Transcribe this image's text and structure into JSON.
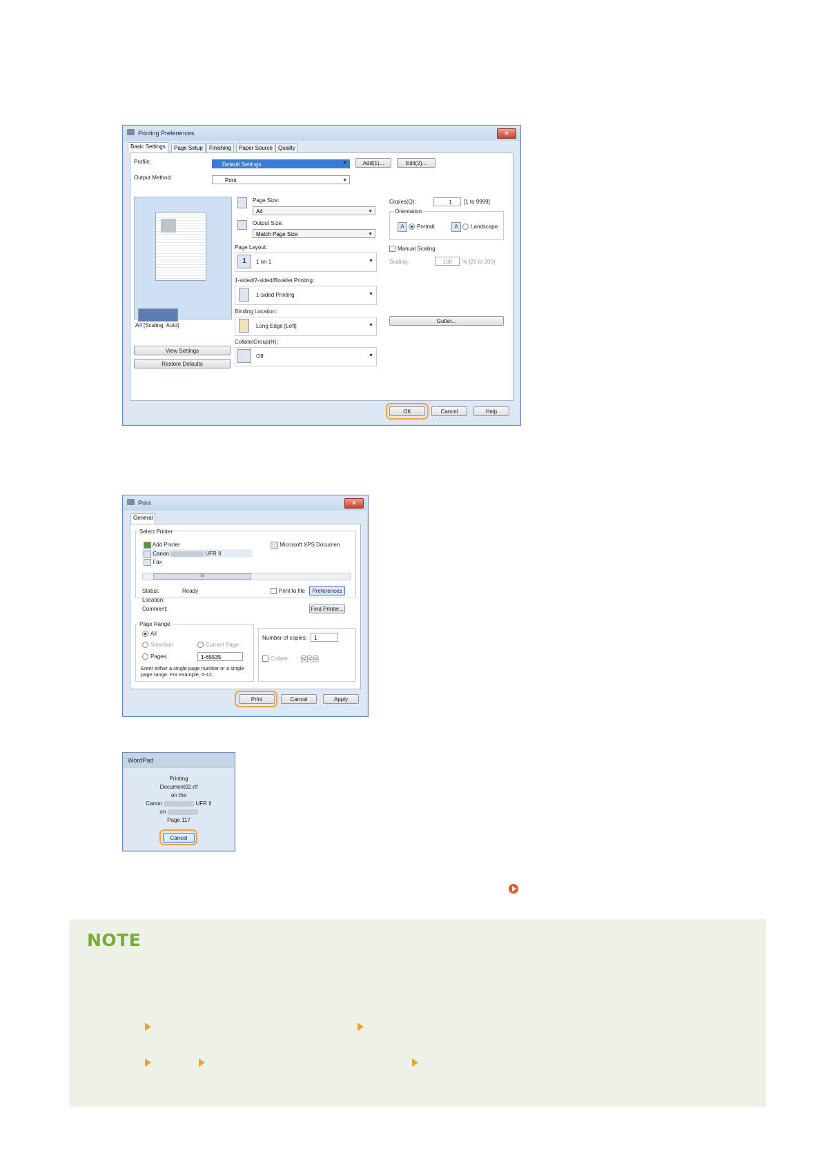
{
  "print_preferences": {
    "title": "Printing Preferences",
    "tabs": [
      "Basic Settings",
      "Page Setup",
      "Finishing",
      "Paper Source",
      "Quality"
    ],
    "profile_label": "Profile:",
    "profile_value": "Default Settings",
    "add_button": "Add(1)...",
    "edit_button": "Edit(2)...",
    "output_method_label": "Output Method:",
    "output_method_value": "Print",
    "page_size_label": "Page Size:",
    "page_size_value": "A4",
    "output_size_label": "Output Size:",
    "output_size_value": "Match Page Size",
    "page_layout_label": "Page Layout:",
    "page_layout_value": "1 on 1",
    "sided_label": "1-sided/2-sided/Booklet Printing:",
    "sided_value": "1-sided Printing",
    "binding_label": "Binding Location:",
    "binding_value": "Long Edge [Left]",
    "collate_label": "Collate/Group(H):",
    "collate_value": "Off",
    "copies_label": "Copies(Q):",
    "copies_value": "1",
    "copies_range": "[1 to 9999]",
    "orientation_label": "Orientation",
    "portrait": "Portrait",
    "landscape": "Landscape",
    "manual_scaling": "Manual Scaling",
    "scaling_label": "Scaling:",
    "scaling_value": "100",
    "scaling_range": "% [25 to 200]",
    "gutter_button": "Gutter...",
    "preview_caption": "A4 [Scaling: Auto]",
    "view_settings": "View Settings",
    "restore_defaults": "Restore Defaults",
    "ok": "OK",
    "cancel": "Cancel",
    "help": "Help",
    "layout_icon_text": "1"
  },
  "print_dialog": {
    "title": "Print",
    "tab": "General",
    "select_printer": "Select Printer",
    "printers": [
      "Add Printer",
      "Canon",
      "Fax"
    ],
    "printer_suffix": "UFR II",
    "xps": "Microsoft XPS Documen",
    "scroll_mid": "III",
    "status_label": "Status:",
    "status_value": "Ready",
    "location_label": "Location:",
    "comment_label": "Comment:",
    "print_to_file": "Print to file",
    "preferences": "Preferences",
    "find_printer": "Find Printer...",
    "page_range": "Page Range",
    "all": "All",
    "selection": "Selection",
    "current_page": "Current Page",
    "pages": "Pages:",
    "pages_value": "1-65535",
    "hint1": "Enter either a single page number or a single",
    "hint2": "page range.  For example, 5-12",
    "num_copies": "Number of copies:",
    "num_copies_value": "1",
    "collate": "Collate",
    "print": "Print",
    "cancel": "Cancel",
    "apply": "Apply"
  },
  "wordpad_dialog": {
    "title": "WordPad",
    "lines": [
      "Printing",
      "Document02.rtf",
      "on the"
    ],
    "canon": "Canon",
    "ufr": "UFR II",
    "on": "on",
    "page": "Page 117",
    "cancel": "Cancel"
  },
  "note": {
    "title": "NOTE"
  }
}
